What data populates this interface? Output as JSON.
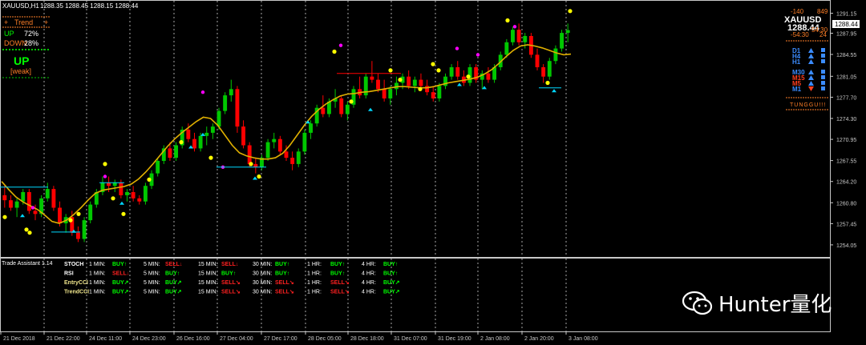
{
  "colors": {
    "bg": "#000000",
    "grid": "#d0d0d0",
    "bull": "#00c800",
    "bear": "#ff0000",
    "ma": "#e0b000",
    "axis_text": "#c8c8c8",
    "dot": "#ffff00",
    "magenta": "#ff00ff",
    "cyan": "#00d8ff",
    "orange": "#ff7f27",
    "pale_yellow": "#f0e68c"
  },
  "header": {
    "symbol": "XAUUSD,H1",
    "ohlc": "1288.35 1288.45 1288.15 1288.44"
  },
  "trend_panel": {
    "title": "Trend",
    "up_label": "UP",
    "up_pct": "72%",
    "down_label": "DOWN",
    "down_pct": "28%",
    "signal": "UP",
    "strength": "[weak]"
  },
  "right_panel": {
    "symbol": "XAUUSD",
    "price": "1288.44",
    "n1": "-140",
    "n2": "849",
    "n3": "-54:30",
    "n4": "54:30",
    "n5": "24",
    "timeframes": [
      {
        "tf": "D1",
        "dir": "up"
      },
      {
        "tf": "H4",
        "dir": "up"
      },
      {
        "tf": "H1",
        "dir": "up"
      },
      {
        "tf": "M30",
        "dir": "up"
      },
      {
        "tf": "M15",
        "dir": "up"
      },
      {
        "tf": "M5",
        "dir": "up"
      },
      {
        "tf": "M1",
        "dir": "down"
      }
    ],
    "status": "TUNGGU!!!"
  },
  "assistant": {
    "title": "Trade Assistant 1.14",
    "rows": [
      {
        "name": "STOCH",
        "cells": [
          {
            "tf": "1 MIN:",
            "sig": "BUY↑"
          },
          {
            "tf": "5 MIN:",
            "sig": "SELL↓"
          },
          {
            "tf": "15 MIN:",
            "sig": "SELL↓"
          },
          {
            "tf": "30 MIN:",
            "sig": "BUY↑"
          },
          {
            "tf": "1 HR:",
            "sig": "BUY↑"
          },
          {
            "tf": "4 HR:",
            "sig": "BUY↑"
          }
        ]
      },
      {
        "name": "RSI",
        "cells": [
          {
            "tf": "1 MIN:",
            "sig": "SELL↓"
          },
          {
            "tf": "5 MIN:",
            "sig": "BUY↑"
          },
          {
            "tf": "15 MIN:",
            "sig": "BUY↑"
          },
          {
            "tf": "30 MIN:",
            "sig": "BUY↑"
          },
          {
            "tf": "1 HR:",
            "sig": "BUY↑"
          },
          {
            "tf": "4 HR:",
            "sig": "BUY↑"
          }
        ]
      },
      {
        "name": "EntryCCI",
        "cells": [
          {
            "tf": "1 MIN:",
            "sig": "BUY↗"
          },
          {
            "tf": "5 MIN:",
            "sig": "BUY↗"
          },
          {
            "tf": "15 MIN:",
            "sig": "SELL↘"
          },
          {
            "tf": "30 MIN:",
            "sig": "SELL↘"
          },
          {
            "tf": "1 HR:",
            "sig": "SELL↘"
          },
          {
            "tf": "4 HR:",
            "sig": "BUY↗"
          }
        ]
      },
      {
        "name": "TrendCCI",
        "cells": [
          {
            "tf": "1 MIN:",
            "sig": "BUY↗"
          },
          {
            "tf": "5 MIN:",
            "sig": "BUY↗"
          },
          {
            "tf": "15 MIN:",
            "sig": "SELL↘"
          },
          {
            "tf": "30 MIN:",
            "sig": "SELL↘"
          },
          {
            "tf": "1 HR:",
            "sig": "SELL↘"
          },
          {
            "tf": "4 HR:",
            "sig": "BUY↗"
          }
        ]
      }
    ]
  },
  "watermark": {
    "text": "Hunter量化"
  },
  "chart_data": {
    "type": "candlestick",
    "ylim": [
      1252.5,
      1292.5
    ],
    "y_ticks": [
      1291.15,
      1287.95,
      1284.55,
      1281.05,
      1277.7,
      1274.3,
      1270.95,
      1267.55,
      1264.2,
      1260.8,
      1257.45,
      1254.05
    ],
    "x_ticks": [
      "21 Dec 2018",
      "21 Dec 22:00",
      "24 Dec 11:00",
      "24 Dec 23:00",
      "26 Dec 16:00",
      "27 Dec 04:00",
      "27 Dec 17:00",
      "28 Dec 05:00",
      "28 Dec 18:00",
      "31 Dec 07:00",
      "31 Dec 19:00",
      "2 Jan 08:00",
      "2 Jan 20:00",
      "3 Jan 08:00"
    ],
    "price_label": "1288.44",
    "candles": [
      [
        1262.0,
        1263.5,
        1260.0,
        1261.2
      ],
      [
        1261.2,
        1262.0,
        1259.5,
        1260.0
      ],
      [
        1260.0,
        1261.5,
        1258.5,
        1261.0
      ],
      [
        1261.0,
        1263.0,
        1260.5,
        1262.5
      ],
      [
        1262.5,
        1263.0,
        1259.0,
        1259.5
      ],
      [
        1259.5,
        1260.5,
        1258.0,
        1259.0
      ],
      [
        1259.0,
        1262.0,
        1258.5,
        1261.5
      ],
      [
        1261.5,
        1264.0,
        1261.0,
        1263.0
      ],
      [
        1263.0,
        1263.5,
        1259.5,
        1260.0
      ],
      [
        1260.0,
        1261.0,
        1257.0,
        1257.5
      ],
      [
        1257.5,
        1259.0,
        1256.0,
        1258.5
      ],
      [
        1258.5,
        1259.5,
        1255.5,
        1256.0
      ],
      [
        1256.0,
        1257.0,
        1254.5,
        1255.0
      ],
      [
        1255.0,
        1258.5,
        1254.5,
        1258.0
      ],
      [
        1258.0,
        1261.0,
        1257.5,
        1260.5
      ],
      [
        1260.5,
        1263.0,
        1260.0,
        1262.5
      ],
      [
        1262.5,
        1265.0,
        1262.0,
        1264.0
      ],
      [
        1264.0,
        1265.0,
        1262.5,
        1263.5
      ],
      [
        1263.5,
        1264.5,
        1262.5,
        1264.0
      ],
      [
        1264.0,
        1264.5,
        1261.5,
        1262.0
      ],
      [
        1262.0,
        1263.0,
        1261.0,
        1262.5
      ],
      [
        1262.5,
        1263.5,
        1261.0,
        1261.5
      ],
      [
        1261.5,
        1262.0,
        1260.5,
        1261.0
      ],
      [
        1261.0,
        1264.0,
        1260.5,
        1263.5
      ],
      [
        1263.5,
        1266.0,
        1263.0,
        1265.5
      ],
      [
        1265.5,
        1268.0,
        1265.0,
        1267.5
      ],
      [
        1267.5,
        1270.0,
        1267.0,
        1269.5
      ],
      [
        1269.5,
        1270.5,
        1267.5,
        1268.0
      ],
      [
        1268.0,
        1270.5,
        1267.5,
        1270.0
      ],
      [
        1270.0,
        1273.0,
        1269.5,
        1272.5
      ],
      [
        1272.5,
        1273.5,
        1270.5,
        1271.0
      ],
      [
        1271.0,
        1272.0,
        1269.0,
        1269.5
      ],
      [
        1269.5,
        1272.0,
        1269.0,
        1271.5
      ],
      [
        1271.5,
        1273.0,
        1270.0,
        1272.0
      ],
      [
        1272.0,
        1273.5,
        1271.0,
        1273.0
      ],
      [
        1273.0,
        1276.0,
        1272.5,
        1275.5
      ],
      [
        1275.5,
        1278.5,
        1275.0,
        1278.0
      ],
      [
        1278.0,
        1280.5,
        1277.0,
        1279.0
      ],
      [
        1279.0,
        1279.5,
        1272.0,
        1273.0
      ],
      [
        1273.0,
        1274.0,
        1269.5,
        1270.0
      ],
      [
        1270.0,
        1270.5,
        1266.5,
        1267.0
      ],
      [
        1267.0,
        1268.0,
        1265.5,
        1266.5
      ],
      [
        1266.5,
        1268.5,
        1266.0,
        1268.0
      ],
      [
        1268.0,
        1271.0,
        1267.5,
        1270.5
      ],
      [
        1270.5,
        1272.0,
        1269.5,
        1271.0
      ],
      [
        1271.0,
        1271.5,
        1268.5,
        1269.0
      ],
      [
        1269.0,
        1270.0,
        1267.5,
        1268.0
      ],
      [
        1268.0,
        1269.0,
        1266.0,
        1267.0
      ],
      [
        1267.0,
        1269.5,
        1266.5,
        1269.0
      ],
      [
        1269.0,
        1272.5,
        1268.5,
        1272.0
      ],
      [
        1272.0,
        1274.0,
        1271.0,
        1273.5
      ],
      [
        1273.5,
        1276.5,
        1273.0,
        1276.0
      ],
      [
        1276.0,
        1278.0,
        1274.5,
        1275.0
      ],
      [
        1275.0,
        1277.5,
        1274.5,
        1277.0
      ],
      [
        1277.0,
        1279.0,
        1276.0,
        1277.5
      ],
      [
        1277.5,
        1278.0,
        1274.5,
        1275.0
      ],
      [
        1275.0,
        1277.0,
        1274.0,
        1276.5
      ],
      [
        1276.5,
        1279.5,
        1276.0,
        1279.0
      ],
      [
        1279.0,
        1281.0,
        1277.5,
        1278.0
      ],
      [
        1278.0,
        1281.5,
        1277.5,
        1281.0
      ],
      [
        1281.0,
        1283.5,
        1280.0,
        1280.5
      ],
      [
        1280.5,
        1281.5,
        1278.5,
        1279.0
      ],
      [
        1279.0,
        1280.5,
        1277.0,
        1277.5
      ],
      [
        1277.5,
        1279.5,
        1276.5,
        1279.0
      ],
      [
        1279.0,
        1281.0,
        1278.0,
        1280.0
      ],
      [
        1280.0,
        1281.5,
        1279.0,
        1281.0
      ],
      [
        1281.0,
        1282.0,
        1279.0,
        1279.5
      ],
      [
        1279.5,
        1281.0,
        1278.5,
        1280.5
      ],
      [
        1280.5,
        1281.5,
        1279.0,
        1279.5
      ],
      [
        1279.5,
        1280.5,
        1278.0,
        1278.5
      ],
      [
        1278.5,
        1279.5,
        1277.0,
        1277.5
      ],
      [
        1277.5,
        1280.0,
        1277.0,
        1279.5
      ],
      [
        1279.5,
        1281.5,
        1279.0,
        1281.0
      ],
      [
        1281.0,
        1283.0,
        1280.5,
        1282.5
      ],
      [
        1282.5,
        1283.5,
        1280.5,
        1281.0
      ],
      [
        1281.0,
        1282.0,
        1279.5,
        1280.0
      ],
      [
        1280.0,
        1283.0,
        1279.5,
        1282.5
      ],
      [
        1282.5,
        1283.0,
        1280.0,
        1280.5
      ],
      [
        1280.5,
        1282.0,
        1279.0,
        1281.5
      ],
      [
        1281.5,
        1282.5,
        1280.0,
        1280.5
      ],
      [
        1280.5,
        1283.0,
        1280.0,
        1282.5
      ],
      [
        1282.5,
        1285.0,
        1282.0,
        1284.5
      ],
      [
        1284.5,
        1287.0,
        1284.0,
        1286.5
      ],
      [
        1286.5,
        1289.0,
        1286.0,
        1288.5
      ],
      [
        1288.5,
        1289.5,
        1286.0,
        1286.5
      ],
      [
        1286.5,
        1288.0,
        1285.5,
        1287.5
      ],
      [
        1287.5,
        1288.0,
        1284.0,
        1284.5
      ],
      [
        1284.5,
        1285.5,
        1282.0,
        1282.5
      ],
      [
        1282.5,
        1283.0,
        1280.0,
        1281.0
      ],
      [
        1281.0,
        1284.0,
        1280.5,
        1283.5
      ],
      [
        1283.5,
        1286.0,
        1283.0,
        1285.5
      ],
      [
        1285.5,
        1288.5,
        1285.0,
        1288.0
      ],
      [
        1288.0,
        1289.5,
        1286.5,
        1288.44
      ]
    ],
    "ma": [
      1264.2,
      1262.9,
      1261.7,
      1260.9,
      1260.3,
      1259.7,
      1258.8,
      1257.8,
      1257.5,
      1258.0,
      1258.9,
      1260.0,
      1261.2,
      1262.3,
      1262.8,
      1263.0,
      1263.2,
      1263.4,
      1263.8,
      1264.6,
      1265.7,
      1267.0,
      1268.4,
      1269.8,
      1271.0,
      1272.0,
      1272.9,
      1273.8,
      1274.5,
      1274.3,
      1273.2,
      1271.6,
      1270.0,
      1268.8,
      1268.3,
      1268.0,
      1267.8,
      1267.8,
      1268.0,
      1268.7,
      1270.0,
      1271.6,
      1273.2,
      1274.6,
      1275.7,
      1276.6,
      1277.3,
      1277.9,
      1278.2,
      1278.3,
      1278.5,
      1278.6,
      1278.8,
      1279.0,
      1279.2,
      1279.4,
      1279.4,
      1279.3,
      1279.2,
      1279.2,
      1279.4,
      1279.7,
      1280.0,
      1280.2,
      1280.4,
      1280.6,
      1280.9,
      1281.4,
      1282.1,
      1283.1,
      1284.2,
      1285.2,
      1285.9,
      1286.1,
      1285.9,
      1285.6,
      1285.2,
      1284.8,
      1284.5,
      1284.6
    ]
  }
}
